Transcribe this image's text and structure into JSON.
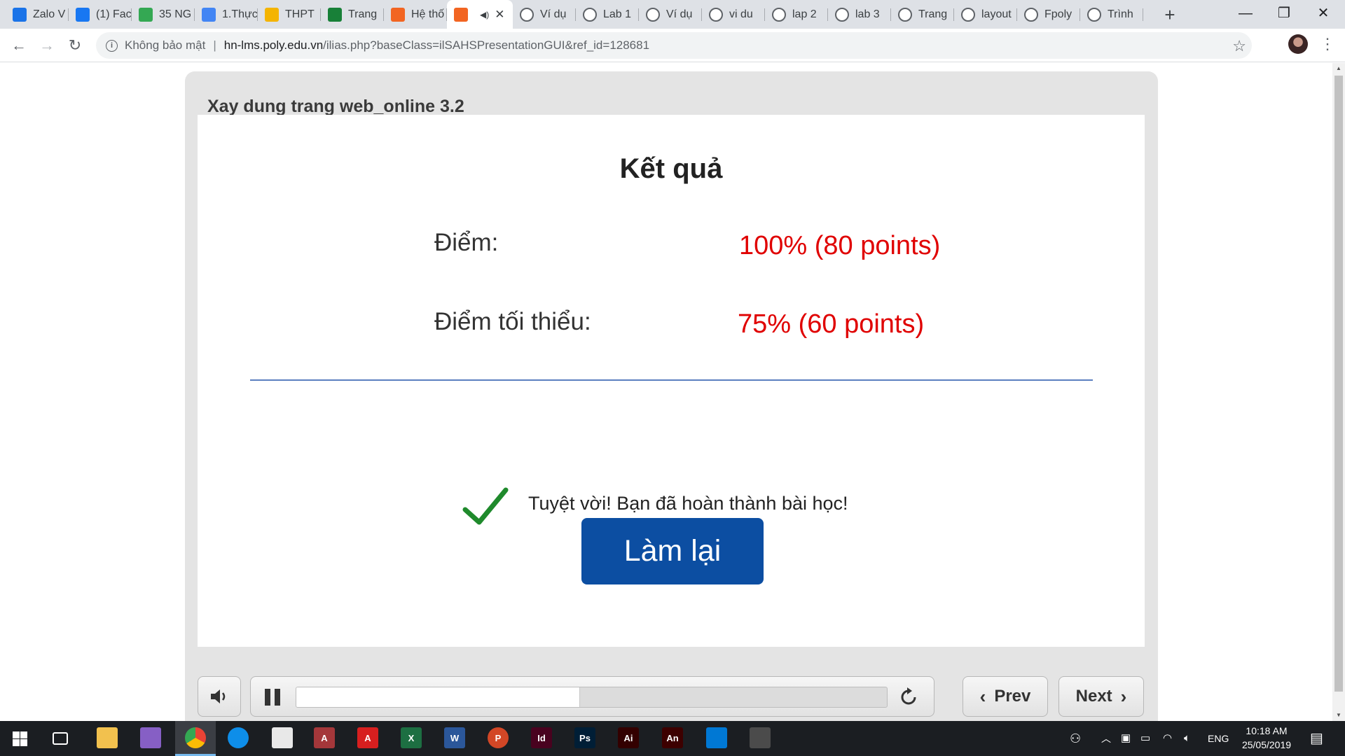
{
  "browser": {
    "tabs": [
      {
        "title": "Zalo V",
        "icon": "zalo-icon",
        "color": "#1a73e8"
      },
      {
        "title": "(1) Fac",
        "icon": "facebook-icon",
        "color": "#1877f2"
      },
      {
        "title": "35 NG",
        "icon": "drive-icon",
        "color": "#34a853"
      },
      {
        "title": "1.Thực",
        "icon": "docs-icon",
        "color": "#4285f4"
      },
      {
        "title": "THPT",
        "icon": "emoji-icon",
        "color": "#f4b400"
      },
      {
        "title": "Trang",
        "icon": "checkmark-icon",
        "color": "#188038"
      },
      {
        "title": "Hệ thố",
        "icon": "fpt-icon",
        "color": "#f26522"
      },
      {
        "title": "",
        "icon": "fpt-icon",
        "color": "#f26522",
        "active": true
      },
      {
        "title": "Ví dụ",
        "icon": "globe-icon"
      },
      {
        "title": "Lab 1",
        "icon": "globe-icon"
      },
      {
        "title": "Ví dụ",
        "icon": "globe-icon"
      },
      {
        "title": "vi du",
        "icon": "globe-icon"
      },
      {
        "title": "lap 2",
        "icon": "globe-icon"
      },
      {
        "title": "lab 3",
        "icon": "globe-icon"
      },
      {
        "title": "Trang",
        "icon": "globe-icon"
      },
      {
        "title": "layout",
        "icon": "globe-icon"
      },
      {
        "title": "Fpoly",
        "icon": "globe-icon"
      },
      {
        "title": "Trình",
        "icon": "globe-icon"
      }
    ],
    "new_tab": "+",
    "minimize": "—",
    "maximize": "❐",
    "close": "✕",
    "security_label": "Không bảo mật",
    "url_host": "hn-lms.poly.edu.vn",
    "url_path": "/ilias.php?baseClass=ilSAHSPresentationGUI&ref_id=128681"
  },
  "player": {
    "course_title": "Xay dung trang web_online 3.2",
    "result_heading": "Kết quả",
    "score_label": "Điểm:",
    "score_value": "100% (80 points)",
    "min_score_label": "Điểm tối thiểu:",
    "min_score_value": "75% (60 points)",
    "completion_message": "Tuyệt vời! Bạn đã hoàn thành bài học!",
    "retry_label": "Làm lại",
    "progress": 0.48,
    "prev_label": "Prev",
    "next_label": "Next",
    "accent_color": "#0c4ea2",
    "score_color": "#e00000"
  },
  "taskbar": {
    "apps": [
      {
        "icon": "task-view-icon",
        "label": "",
        "color": "#1b1e22"
      },
      {
        "icon": "file-explorer-icon",
        "label": "",
        "color": "#f2c14e"
      },
      {
        "icon": "visual-studio-icon",
        "label": "",
        "color": "#865fc5"
      },
      {
        "icon": "chrome-icon",
        "label": "",
        "color": "#ea4335"
      },
      {
        "icon": "teamviewer-icon",
        "label": "",
        "color": "#0e8ee9"
      },
      {
        "icon": "paint-app-icon",
        "label": "",
        "color": "#e8e8e8"
      },
      {
        "icon": "access-icon",
        "label": "A",
        "color": "#a4373a"
      },
      {
        "icon": "acrobat-icon",
        "label": "A",
        "color": "#d71f1f"
      },
      {
        "icon": "excel-icon",
        "label": "X",
        "color": "#1d6f42"
      },
      {
        "icon": "word-icon",
        "label": "W",
        "color": "#2b579a"
      },
      {
        "icon": "powerpoint-icon",
        "label": "P",
        "color": "#d24726"
      },
      {
        "icon": "indesign-icon",
        "label": "Id",
        "color": "#49021f"
      },
      {
        "icon": "photoshop-icon",
        "label": "Ps",
        "color": "#001e36"
      },
      {
        "icon": "illustrator-icon",
        "label": "Ai",
        "color": "#330000"
      },
      {
        "icon": "animate-icon",
        "label": "An",
        "color": "#3d0000"
      },
      {
        "icon": "vscode-icon",
        "label": "",
        "color": "#0078d4"
      },
      {
        "icon": "sublime-icon",
        "label": "",
        "color": "#4b4b4b"
      }
    ],
    "language": "ENG",
    "time": "10:18 AM",
    "date": "25/05/2019"
  }
}
